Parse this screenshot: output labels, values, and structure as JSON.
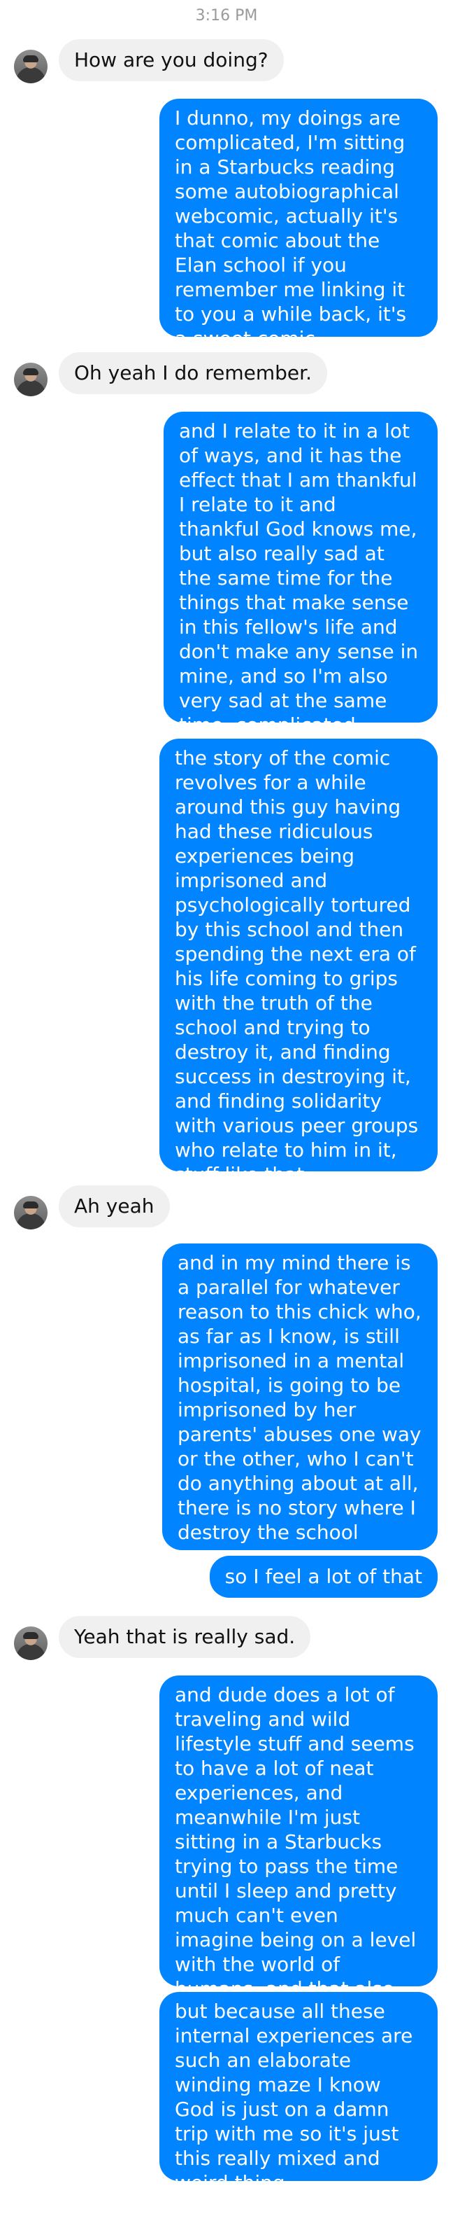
{
  "header": {
    "timestamp": "3:16 PM"
  },
  "messages": [
    {
      "from": "them",
      "text": "How are you doing?"
    },
    {
      "from": "me",
      "text": "I dunno, my doings are complicated, I'm sitting in a Starbucks reading some autobiographical webcomic, actually it's that comic about the Elan school if you remember me linking it to you a while back, it's a sweet comic"
    },
    {
      "from": "them",
      "text": "Oh yeah I do remember."
    },
    {
      "from": "me",
      "text": "and I relate to it in a lot of ways, and it has the effect that I am thankful I relate to it and thankful God knows me, but also really sad at the same time for the things that make sense in this fellow's life and don't make any sense in mine, and so I'm also very sad at the same time, complicated doings"
    },
    {
      "from": "me",
      "text": "the story of the comic revolves for a while around this guy having had these ridiculous experiences being imprisoned and psychologically tortured by this school and then spending the next era of his life coming to grips with the truth of the school and trying to destroy it, and finding success in destroying it, and finding solidarity with various peer groups who relate to him in it, stuff like that"
    },
    {
      "from": "them",
      "text": "Ah yeah"
    },
    {
      "from": "me",
      "text": "and in my mind there is a parallel for whatever reason to this chick who, as far as I know, is still imprisoned in a mental hospital, is going to be imprisoned by her parents' abuses one way or the other, who I can't do anything about at all, there is no story where I destroy the school"
    },
    {
      "from": "me",
      "text": "so I feel a lot of that"
    },
    {
      "from": "them",
      "text": "Yeah that is really sad."
    },
    {
      "from": "me",
      "text": "and dude does a lot of traveling and wild lifestyle stuff and seems to have a lot of neat experiences, and meanwhile I'm just sitting in a Starbucks trying to pass the time until I sleep and pretty much can't even imagine being on a level with the world of humans, and that also makes me sad"
    },
    {
      "from": "me",
      "text": "but because all these internal experiences are such an elaborate winding maze I know God is just on a damn trip with me so it's just this really mixed and weird thing"
    }
  ],
  "colors": {
    "outgoing": "#0084ff",
    "incoming": "#f1f0f0",
    "timestamp": "#9a9a9a"
  },
  "icons": {
    "avatar": "contact-avatar"
  }
}
